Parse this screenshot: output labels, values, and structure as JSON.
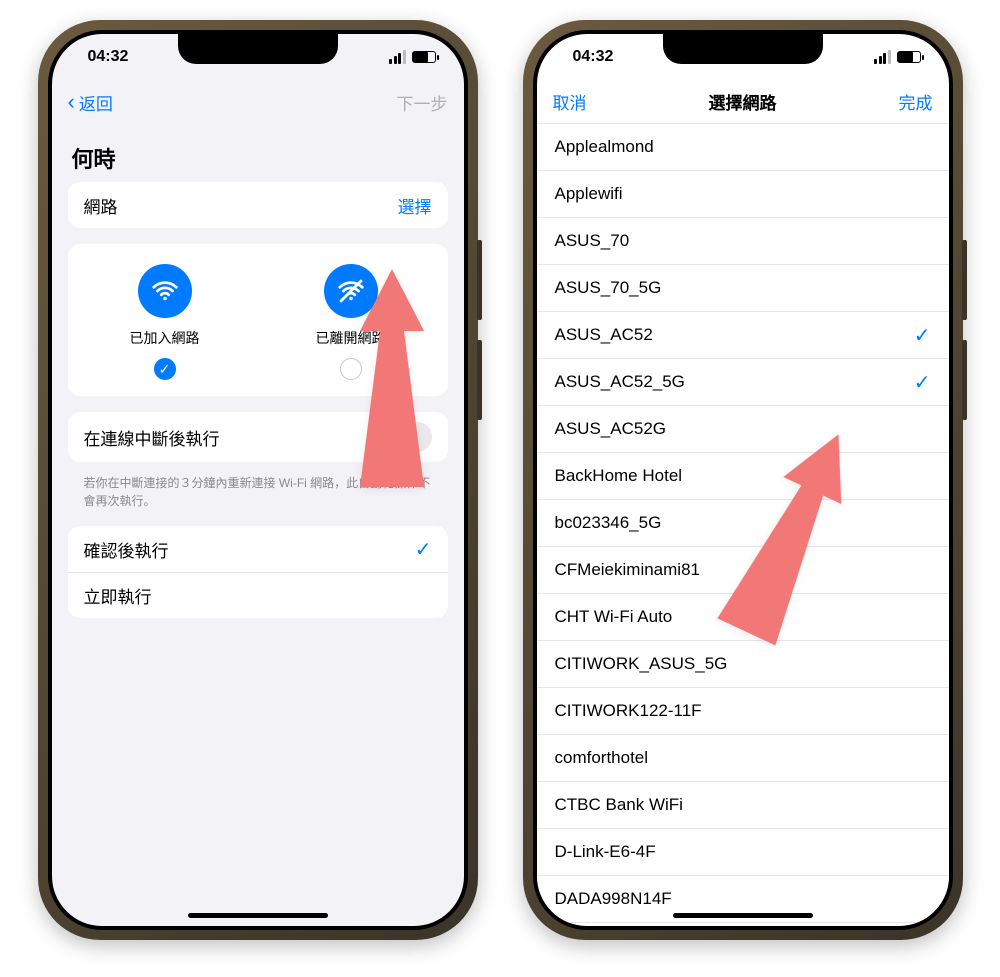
{
  "colors": {
    "accent": "#007aff",
    "arrow": "#f27777"
  },
  "status": {
    "time": "04:32"
  },
  "left": {
    "nav": {
      "back": "返回",
      "next": "下一步"
    },
    "section_title": "何時",
    "network_row": {
      "label": "網路",
      "action": "選擇"
    },
    "choices": {
      "joined": "已加入網路",
      "left": "已離開網路"
    },
    "run_after_disconnect": {
      "label": "在連線中斷後執行",
      "help": "若你在中斷連接的３分鐘內重新連接 Wi-Fi 網路，此自動化操作不會再次執行。"
    },
    "exec": {
      "confirm": "確認後執行",
      "immediate": "立即執行"
    }
  },
  "right": {
    "nav": {
      "cancel": "取消",
      "title": "選擇網路",
      "done": "完成"
    },
    "networks": [
      {
        "name": "Applealmond",
        "selected": false
      },
      {
        "name": "Applewifi",
        "selected": false
      },
      {
        "name": "ASUS_70",
        "selected": false
      },
      {
        "name": "ASUS_70_5G",
        "selected": false
      },
      {
        "name": "ASUS_AC52",
        "selected": true
      },
      {
        "name": "ASUS_AC52_5G",
        "selected": true
      },
      {
        "name": "ASUS_AC52G",
        "selected": false
      },
      {
        "name": "BackHome Hotel",
        "selected": false
      },
      {
        "name": "bc023346_5G",
        "selected": false
      },
      {
        "name": "CFMeiekiminami81",
        "selected": false
      },
      {
        "name": "CHT Wi-Fi Auto",
        "selected": false
      },
      {
        "name": "CITIWORK_ASUS_5G",
        "selected": false
      },
      {
        "name": "CITIWORK122-11F",
        "selected": false
      },
      {
        "name": "comforthotel",
        "selected": false
      },
      {
        "name": "CTBC Bank WiFi",
        "selected": false
      },
      {
        "name": "D-Link-E6-4F",
        "selected": false
      },
      {
        "name": "DADA998N14F",
        "selected": false
      }
    ]
  }
}
